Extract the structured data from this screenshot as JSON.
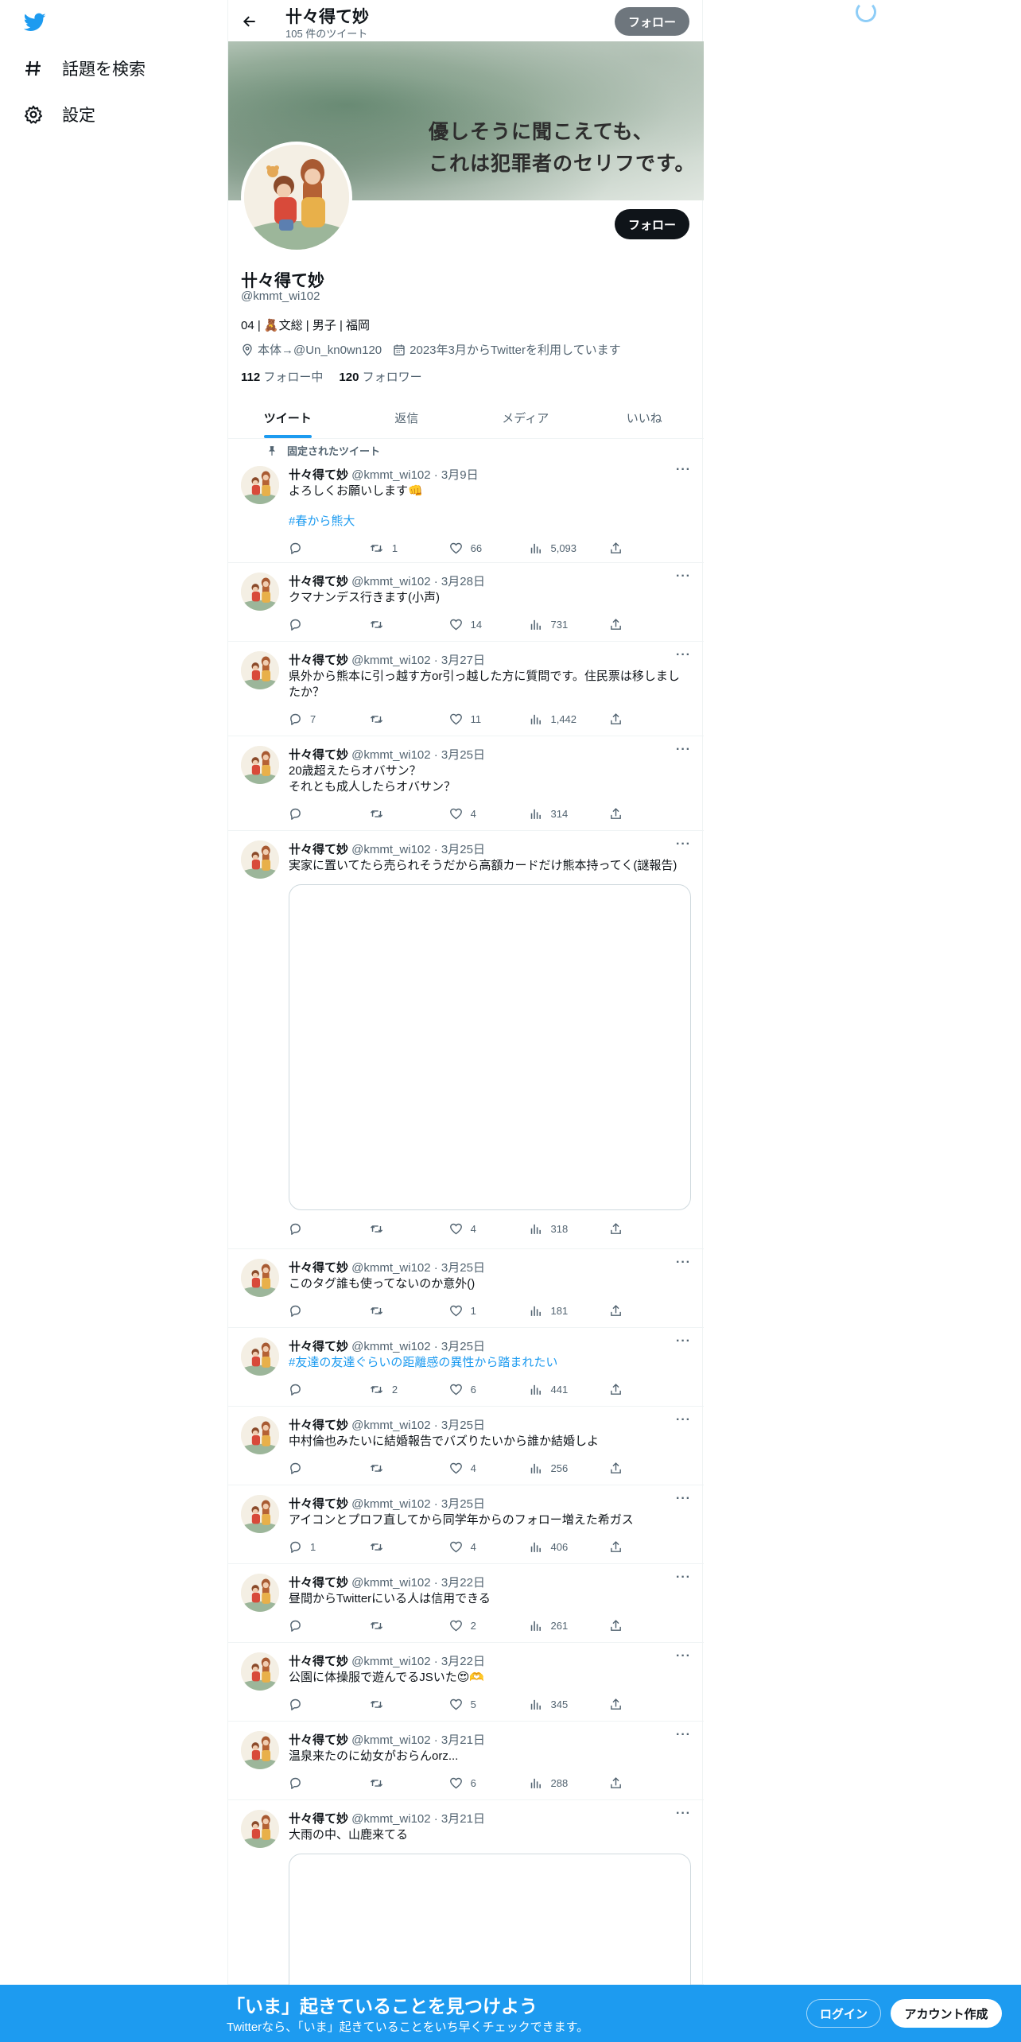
{
  "nav": {
    "explore_label": "話題を検索",
    "settings_label": "設定"
  },
  "header": {
    "name": "卄々得て妙",
    "tweet_count": "105 件のツイート",
    "follow_label": "フォロー"
  },
  "banner": {
    "line1": "優しそうに聞こえても、",
    "line2": "これは犯罪者のセリフです。"
  },
  "profile": {
    "follow_label": "フォロー",
    "name": "卄々得て妙",
    "handle": "@kmmt_wi102",
    "bio": "04 | 🧸文総 | 男子 | 福岡",
    "location": "本体→@Un_kn0wn120",
    "joined": "2023年3月からTwitterを利用しています",
    "following_count": "112",
    "following_label": "フォロー中",
    "followers_count": "120",
    "followers_label": "フォロワー"
  },
  "tabs": [
    "ツイート",
    "返信",
    "メディア",
    "いいね"
  ],
  "pinned_label": "固定されたツイート",
  "tweets": [
    {
      "name": "卄々得て妙",
      "handle": "@kmmt_wi102 · 3月9日",
      "text": "よろしくお願いします👊",
      "tag": "#春から熊大",
      "reply": "",
      "rt": "1",
      "like": "66",
      "views": "5,093"
    },
    {
      "name": "卄々得て妙",
      "handle": "@kmmt_wi102 · 3月28日",
      "text": "クマナンデス行きます(小声)",
      "reply": "",
      "rt": "",
      "like": "14",
      "views": "731"
    },
    {
      "name": "卄々得て妙",
      "handle": "@kmmt_wi102 · 3月27日",
      "text": "県外から熊本に引っ越す方or引っ越した方に質問です。住民票は移しましたか？",
      "reply": "7",
      "rt": "",
      "like": "11",
      "views": "1,442"
    },
    {
      "name": "卄々得て妙",
      "handle": "@kmmt_wi102 · 3月25日",
      "text": "20歳超えたらオバサン？\nそれとも成人したらオバサン？",
      "reply": "",
      "rt": "",
      "like": "4",
      "views": "314"
    },
    {
      "name": "卄々得て妙",
      "handle": "@kmmt_wi102 · 3月25日",
      "text": "実家に置いてたら売られそうだから高額カードだけ熊本持ってく(謎報告)",
      "reply": "",
      "rt": "",
      "like": "4",
      "views": "318"
    },
    {
      "name": "卄々得て妙",
      "handle": "@kmmt_wi102 · 3月25日",
      "text": "このタグ誰も使ってないのか意外()",
      "reply": "",
      "rt": "",
      "like": "1",
      "views": "181"
    },
    {
      "name": "卄々得て妙",
      "handle": "@kmmt_wi102 · 3月25日",
      "text": "#友達の友達ぐらいの距離感の異性から踏まれたい",
      "reply": "",
      "rt": "2",
      "like": "6",
      "views": "441"
    },
    {
      "name": "卄々得て妙",
      "handle": "@kmmt_wi102 · 3月25日",
      "text": "中村倫也みたいに結婚報告でバズりたいから誰か結婚しよ",
      "reply": "",
      "rt": "",
      "like": "4",
      "views": "256"
    },
    {
      "name": "卄々得て妙",
      "handle": "@kmmt_wi102 · 3月25日",
      "text": "アイコンとプロフ直してから同学年からのフォロー増えた希ガス",
      "reply": "1",
      "rt": "",
      "like": "4",
      "views": "406"
    },
    {
      "name": "卄々得て妙",
      "handle": "@kmmt_wi102 · 3月22日",
      "text": "昼間からTwitterにいる人は信用できる",
      "reply": "",
      "rt": "",
      "like": "2",
      "views": "261"
    },
    {
      "name": "卄々得て妙",
      "handle": "@kmmt_wi102 · 3月22日",
      "text": "公園に体操服で遊んでるJSいた😍🫶",
      "reply": "",
      "rt": "",
      "like": "5",
      "views": "345"
    },
    {
      "name": "卄々得て妙",
      "handle": "@kmmt_wi102 · 3月21日",
      "text": "温泉来たのに幼女がおらんorz...",
      "reply": "",
      "rt": "",
      "like": "6",
      "views": "288"
    },
    {
      "name": "卄々得て妙",
      "handle": "@kmmt_wi102 · 3月21日",
      "text": "大雨の中、山鹿来てる"
    }
  ],
  "bottom_bar": {
    "title": "「いま」起きていることを見つけよう",
    "subtitle": "Twitterなら、「いま」起きていることをいち早くチェックできます。",
    "login_label": "ログイン",
    "signup_label": "アカウント作成"
  },
  "colors": {
    "accent": "#1d9bf0",
    "text": "#0f1419",
    "muted": "#536471"
  }
}
